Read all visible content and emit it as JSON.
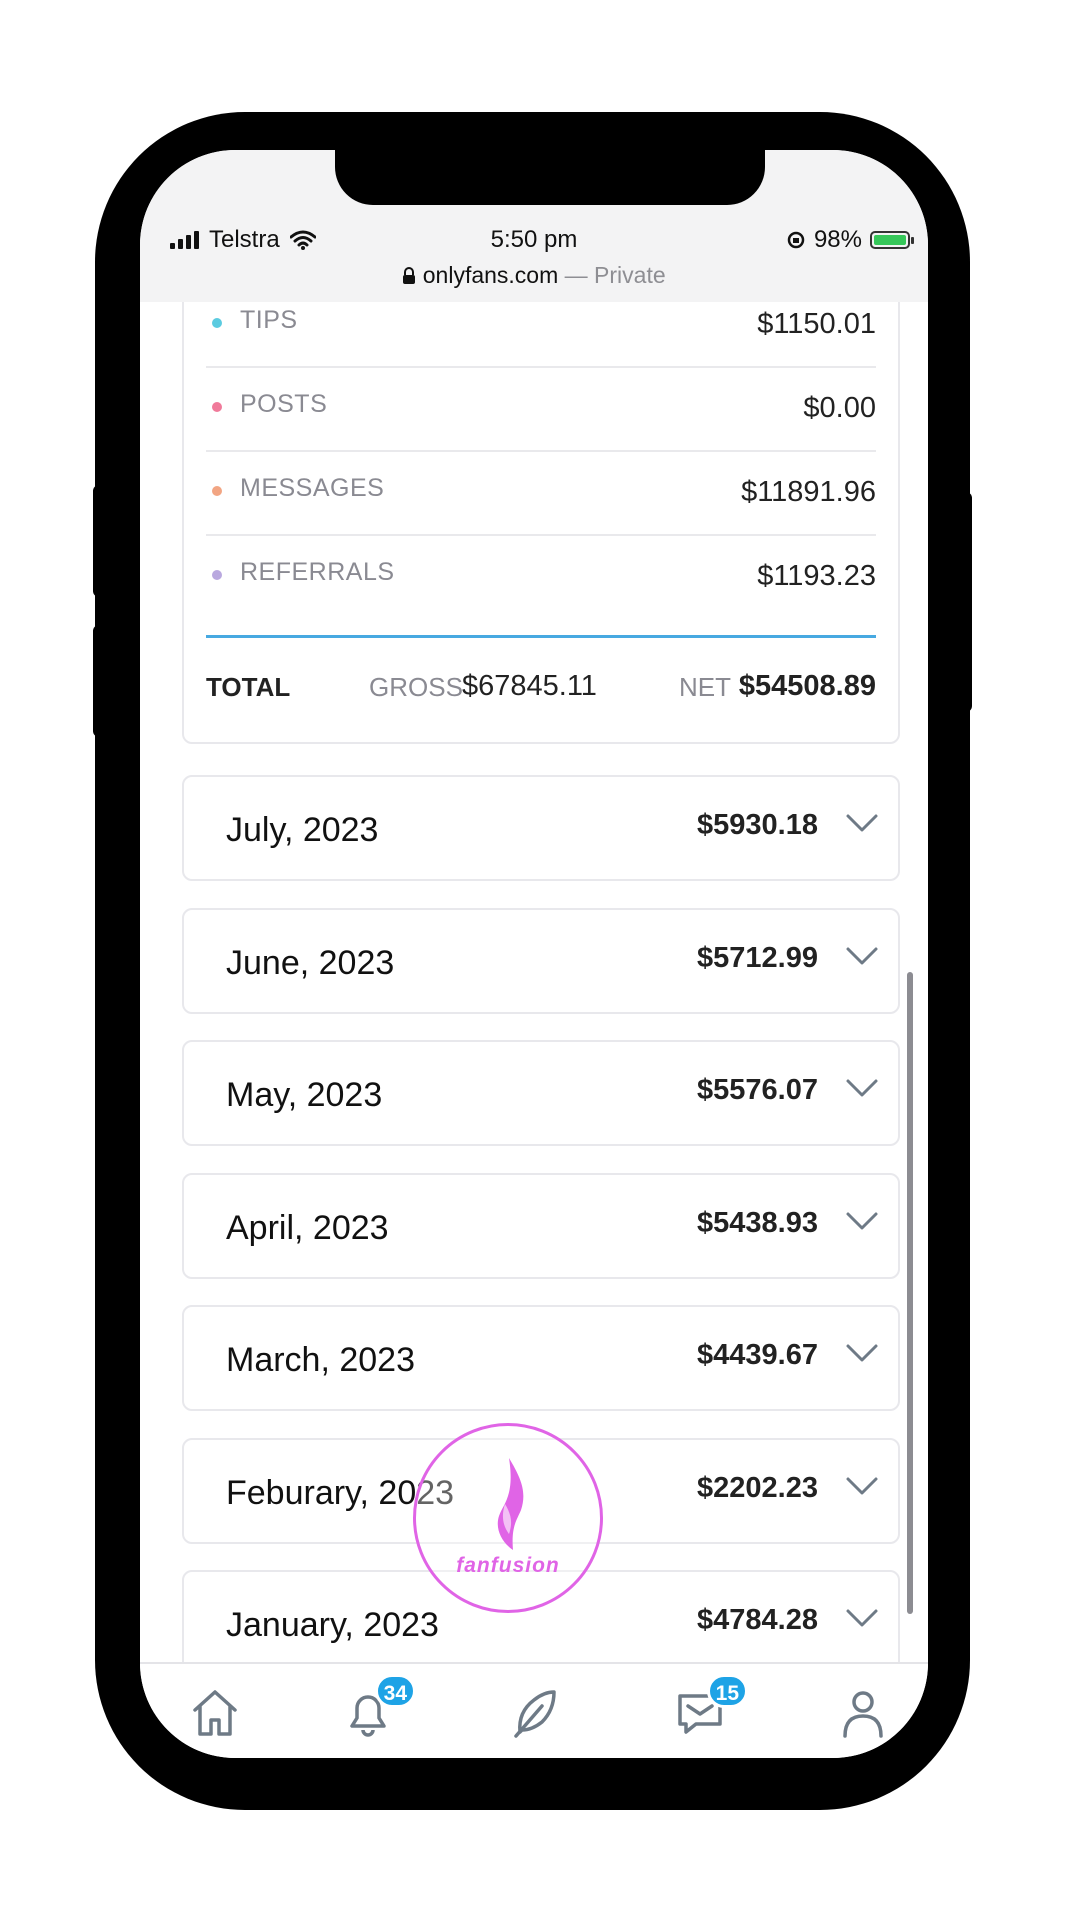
{
  "status_bar": {
    "carrier": "Telstra",
    "time": "5:50 pm",
    "battery": "98%",
    "url": "onlyfans.com",
    "url_suffix": " — Private"
  },
  "summary": {
    "rows": [
      {
        "label": "TIPS",
        "amount": "$1150.01",
        "dot_color": "#5bcbe0"
      },
      {
        "label": "POSTS",
        "amount": "$0.00",
        "dot_color": "#f07a9a"
      },
      {
        "label": "MESSAGES",
        "amount": "$11891.96",
        "dot_color": "#f2a583"
      },
      {
        "label": "REFERRALS",
        "amount": "$1193.23",
        "dot_color": "#b9a8df"
      }
    ],
    "total_label": "TOTAL",
    "gross_label": "GROSS",
    "gross_value": "$67845.11",
    "net_label": "NET",
    "net_value": "$54508.89"
  },
  "months": [
    {
      "name": "July, 2023",
      "amount": "$5930.18"
    },
    {
      "name": "June, 2023",
      "amount": "$5712.99"
    },
    {
      "name": "May, 2023",
      "amount": "$5576.07"
    },
    {
      "name": "April, 2023",
      "amount": "$5438.93"
    },
    {
      "name": "March, 2023",
      "amount": "$4439.67"
    },
    {
      "name": "Feburary, 2023",
      "amount": "$2202.23"
    },
    {
      "name": "January, 2023",
      "amount": "$4784.28"
    }
  ],
  "tabbar": {
    "notifications_badge": "34",
    "messages_badge": "15"
  },
  "watermark": {
    "text": "fanfusion",
    "color": "#e064e6"
  },
  "colors": {
    "accent": "#1ea3e6",
    "divider_blue": "#47a9e1",
    "battery_green": "#35c759"
  }
}
